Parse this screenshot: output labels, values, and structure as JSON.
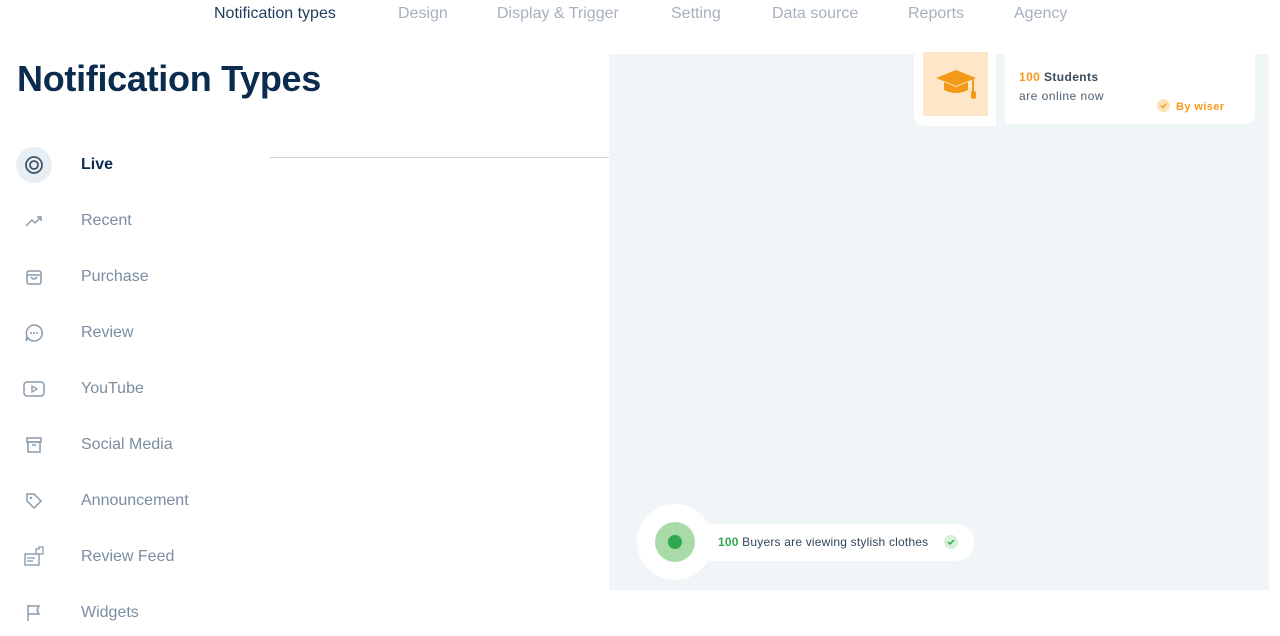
{
  "top_nav": {
    "tabs": [
      {
        "label": "Notification types",
        "active": true
      },
      {
        "label": "Design",
        "active": false
      },
      {
        "label": "Display & Trigger",
        "active": false
      },
      {
        "label": "Setting",
        "active": false
      },
      {
        "label": "Data source",
        "active": false
      },
      {
        "label": "Reports",
        "active": false
      },
      {
        "label": "Agency",
        "active": false
      }
    ]
  },
  "page": {
    "title": "Notification Types"
  },
  "types": [
    {
      "label": "Live",
      "icon": "target-icon",
      "active": true
    },
    {
      "label": "Recent",
      "icon": "trend-icon",
      "active": false
    },
    {
      "label": "Purchase",
      "icon": "bag-icon",
      "active": false
    },
    {
      "label": "Review",
      "icon": "chat-icon",
      "active": false
    },
    {
      "label": "YouTube",
      "icon": "play-icon",
      "active": false
    },
    {
      "label": "Social Media",
      "icon": "archive-icon",
      "active": false
    },
    {
      "label": "Announcement",
      "icon": "tag-icon",
      "active": false
    },
    {
      "label": "Review Feed",
      "icon": "thumbs-feed-icon",
      "active": false
    },
    {
      "label": "Widgets",
      "icon": "flag-icon",
      "active": false
    }
  ],
  "preview": {
    "student_card": {
      "count": "100",
      "label": "Students",
      "subtext": "are online now",
      "brand": "By wiser",
      "icon": "graduation-cap-icon",
      "accent": "#f39a19"
    },
    "buyers_pill": {
      "count": "100",
      "text": "Buyers are viewing stylish clothes",
      "accent": "#2fa84f"
    }
  },
  "colors": {
    "title": "#0b2c4f",
    "inactive": "#7a8da0",
    "panel_bg": "#f0f5f8"
  }
}
